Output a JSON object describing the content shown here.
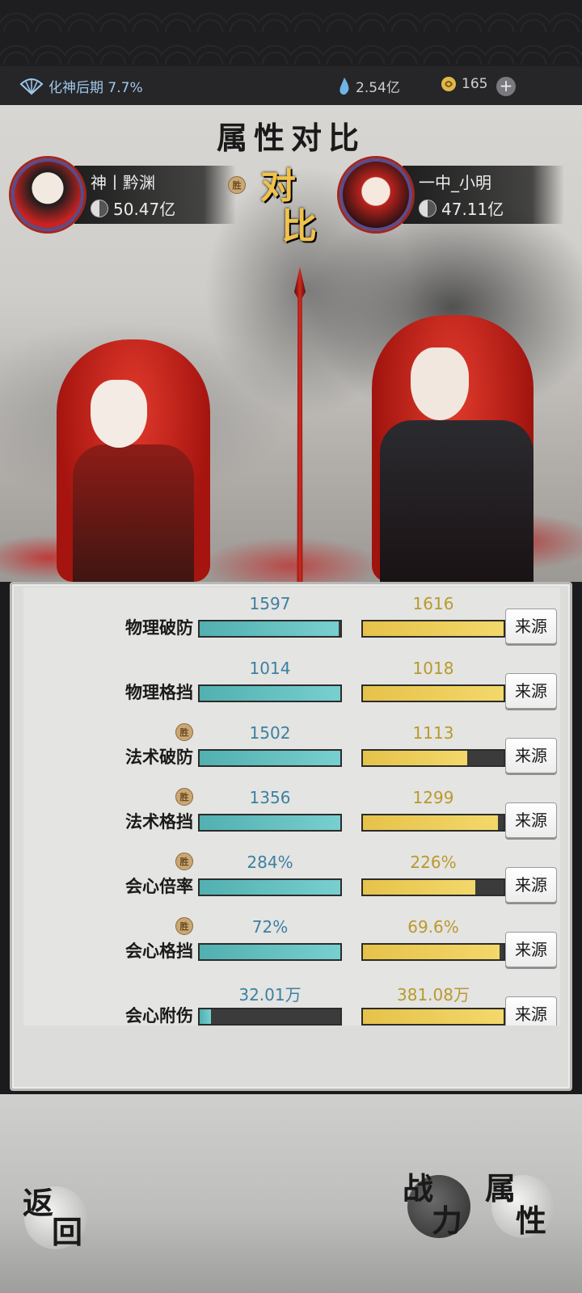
{
  "status": {
    "realm_text": "化神后期 7.7%",
    "spirit_stones": "2.54亿",
    "coins": "165",
    "plus": "+"
  },
  "title": "属性对比",
  "vs_text": {
    "top": "对",
    "bottom": "比"
  },
  "player_left": {
    "name": "神丨黔渊",
    "power": "50.47亿",
    "win_badge": "胜"
  },
  "player_right": {
    "name": "一中_小明",
    "power": "47.11亿"
  },
  "stats": [
    {
      "label": "物理破防",
      "left": "1597",
      "right": "1616",
      "left_fill": 0.99,
      "right_fill": 1.0,
      "win": ""
    },
    {
      "label": "物理格挡",
      "left": "1014",
      "right": "1018",
      "left_fill": 1.0,
      "right_fill": 1.0,
      "win": ""
    },
    {
      "label": "法术破防",
      "left": "1502",
      "right": "1113",
      "left_fill": 1.0,
      "right_fill": 0.74,
      "win": "胜"
    },
    {
      "label": "法术格挡",
      "left": "1356",
      "right": "1299",
      "left_fill": 1.0,
      "right_fill": 0.96,
      "win": "胜"
    },
    {
      "label": "会心倍率",
      "left": "284%",
      "right": "226%",
      "left_fill": 1.0,
      "right_fill": 0.8,
      "win": "胜"
    },
    {
      "label": "会心格挡",
      "left": "72%",
      "right": "69.6%",
      "left_fill": 1.0,
      "right_fill": 0.97,
      "win": "胜"
    },
    {
      "label": "会心附伤",
      "left": "32.01万",
      "right": "381.08万",
      "left_fill": 0.08,
      "right_fill": 1.0,
      "win": ""
    }
  ],
  "source_label": "来源",
  "buttons": {
    "back": [
      "返",
      "回"
    ],
    "combat": [
      "战",
      "力"
    ],
    "attr": [
      "属",
      "性"
    ]
  },
  "colors": {
    "teal": "#5fbcbc",
    "gold": "#ecca55",
    "vs": "#f1c24a"
  }
}
